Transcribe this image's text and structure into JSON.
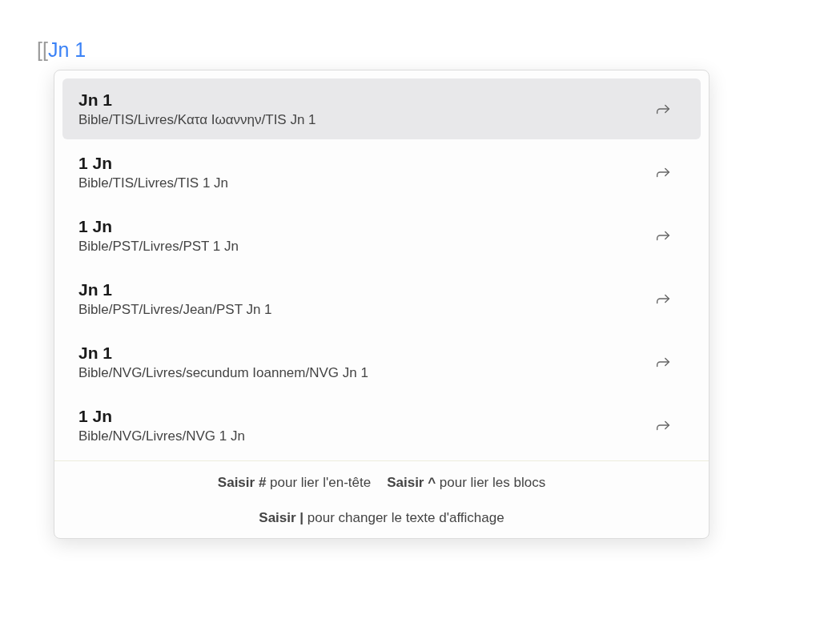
{
  "editor": {
    "brackets": "[[",
    "query": "Jn 1"
  },
  "suggestions": [
    {
      "title": "Jn 1",
      "path": "Bible/TIS/Livres/Κατα Ιωαννην/TIS Jn 1",
      "selected": true
    },
    {
      "title": "1 Jn",
      "path": "Bible/TIS/Livres/TIS 1 Jn",
      "selected": false
    },
    {
      "title": "1 Jn",
      "path": "Bible/PST/Livres/PST 1 Jn",
      "selected": false
    },
    {
      "title": "Jn 1",
      "path": "Bible/PST/Livres/Jean/PST Jn 1",
      "selected": false
    },
    {
      "title": "Jn 1",
      "path": "Bible/NVG/Livres/secundum Ioannem/NVG Jn 1",
      "selected": false
    },
    {
      "title": "1 Jn",
      "path": "Bible/NVG/Livres/NVG 1 Jn",
      "selected": false
    }
  ],
  "instructions": [
    [
      "**Saisir #** pour lier l'en-tête",
      "**Saisir ^** pour lier les blocs"
    ],
    [
      "**Saisir |** pour changer le texte d'affichage"
    ]
  ]
}
